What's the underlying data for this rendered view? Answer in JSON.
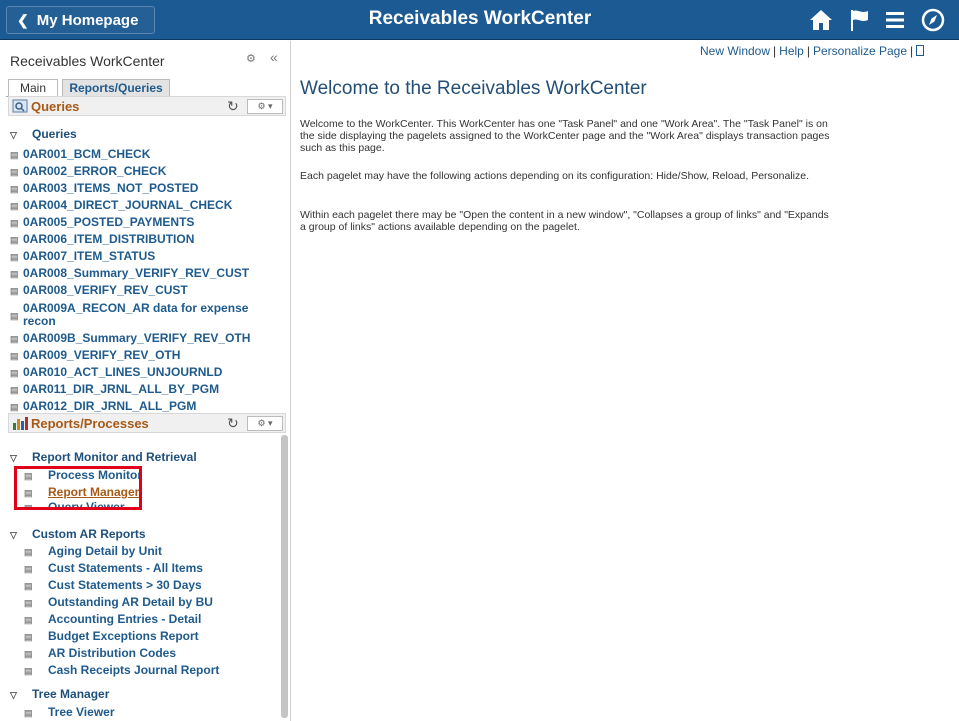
{
  "header": {
    "home_label": "My Homepage",
    "title": "Receivables WorkCenter",
    "icons": [
      "home-icon",
      "flag-icon",
      "menu-icon",
      "compass-icon"
    ]
  },
  "sidebar": {
    "title": "Receivables WorkCenter",
    "tabs": [
      "Main",
      "Reports/Queries"
    ],
    "queries_pagelet": {
      "title": "Queries",
      "group": "Queries",
      "items": [
        "0AR001_BCM_CHECK",
        "0AR002_ERROR_CHECK",
        "0AR003_ITEMS_NOT_POSTED",
        "0AR004_DIRECT_JOURNAL_CHECK",
        "0AR005_POSTED_PAYMENTS",
        "0AR006_ITEM_DISTRIBUTION",
        "0AR007_ITEM_STATUS",
        "0AR008_Summary_VERIFY_REV_CUST",
        "0AR008_VERIFY_REV_CUST",
        "0AR009A_RECON_AR data for expense",
        "recon",
        "0AR009B_Summary_VERIFY_REV_OTH",
        "0AR009_VERIFY_REV_OTH",
        "0AR010_ACT_LINES_UNJOURNLD",
        "0AR011_DIR_JRNL_ALL_BY_PGM",
        "0AR012_DIR_JRNL_ALL_PGM"
      ]
    },
    "reports_pagelet": {
      "title": "Reports/Processes",
      "groups": [
        {
          "label": "Report Monitor and Retrieval",
          "items": [
            "Process Monitor",
            "Report Manager",
            "Query Viewer"
          ]
        },
        {
          "label": "Custom AR Reports",
          "items": [
            "Aging Detail by Unit",
            "Cust Statements - All Items",
            "Cust Statements > 30 Days",
            "Outstanding AR Detail by BU",
            "Accounting Entries - Detail",
            "Budget Exceptions Report",
            "AR Distribution Codes",
            "Cash Receipts Journal Report"
          ]
        },
        {
          "label": "Tree Manager",
          "items": [
            "Tree Viewer"
          ]
        }
      ]
    }
  },
  "main": {
    "links": [
      "New Window",
      "Help",
      "Personalize Page"
    ],
    "title": "Welcome to the Receivables WorkCenter",
    "paragraphs": [
      "Welcome to the WorkCenter. This WorkCenter has one \"Task Panel\" and one \"Work Area\". The \"Task Panel\" is on the side displaying the pagelets assigned to the WorkCenter page and the \"Work Area\" displays transaction pages such as this page.",
      "Each pagelet may have the following actions depending on its configuration: Hide/Show, Reload, Personalize.",
      "Within each pagelet there may be \"Open the content in a new window\", \"Collapses a group of links\" and \"Expands a group of links\" actions available depending on the pagelet."
    ]
  },
  "colors": {
    "header_bg": "#1b5a92",
    "link": "#1f5a8c",
    "highlight": "#e0001a",
    "pagelet_title": "#a65a18"
  }
}
